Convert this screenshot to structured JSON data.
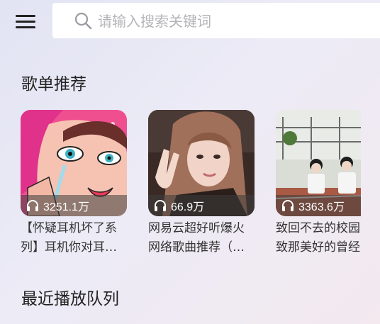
{
  "header": {
    "menu_icon": "hamburger-menu-icon",
    "search": {
      "placeholder": "请输入搜索关键词",
      "value": "",
      "icon": "search-icon"
    }
  },
  "sections": {
    "recommended_title": "歌单推荐",
    "recent_queue_title": "最近播放队列"
  },
  "playlists": [
    {
      "play_count": "3251.1万",
      "title_line1": "【怀疑耳机坏了系",
      "title_line2": "列】耳机你对耳…",
      "cover": "pop-art-crying-woman"
    },
    {
      "play_count": "66.9万",
      "title_line1": "网易云超好听爆火",
      "title_line2": "网络歌曲推荐（…",
      "cover": "girl-peace-sign"
    },
    {
      "play_count": "3363.6万",
      "title_line1": "致回不去的校园",
      "title_line2": "致那美好的曾经",
      "cover": "students-on-track"
    }
  ],
  "colors": {
    "accent_text": "#222222",
    "placeholder": "#b4b4b8",
    "card_text": "#333333"
  }
}
